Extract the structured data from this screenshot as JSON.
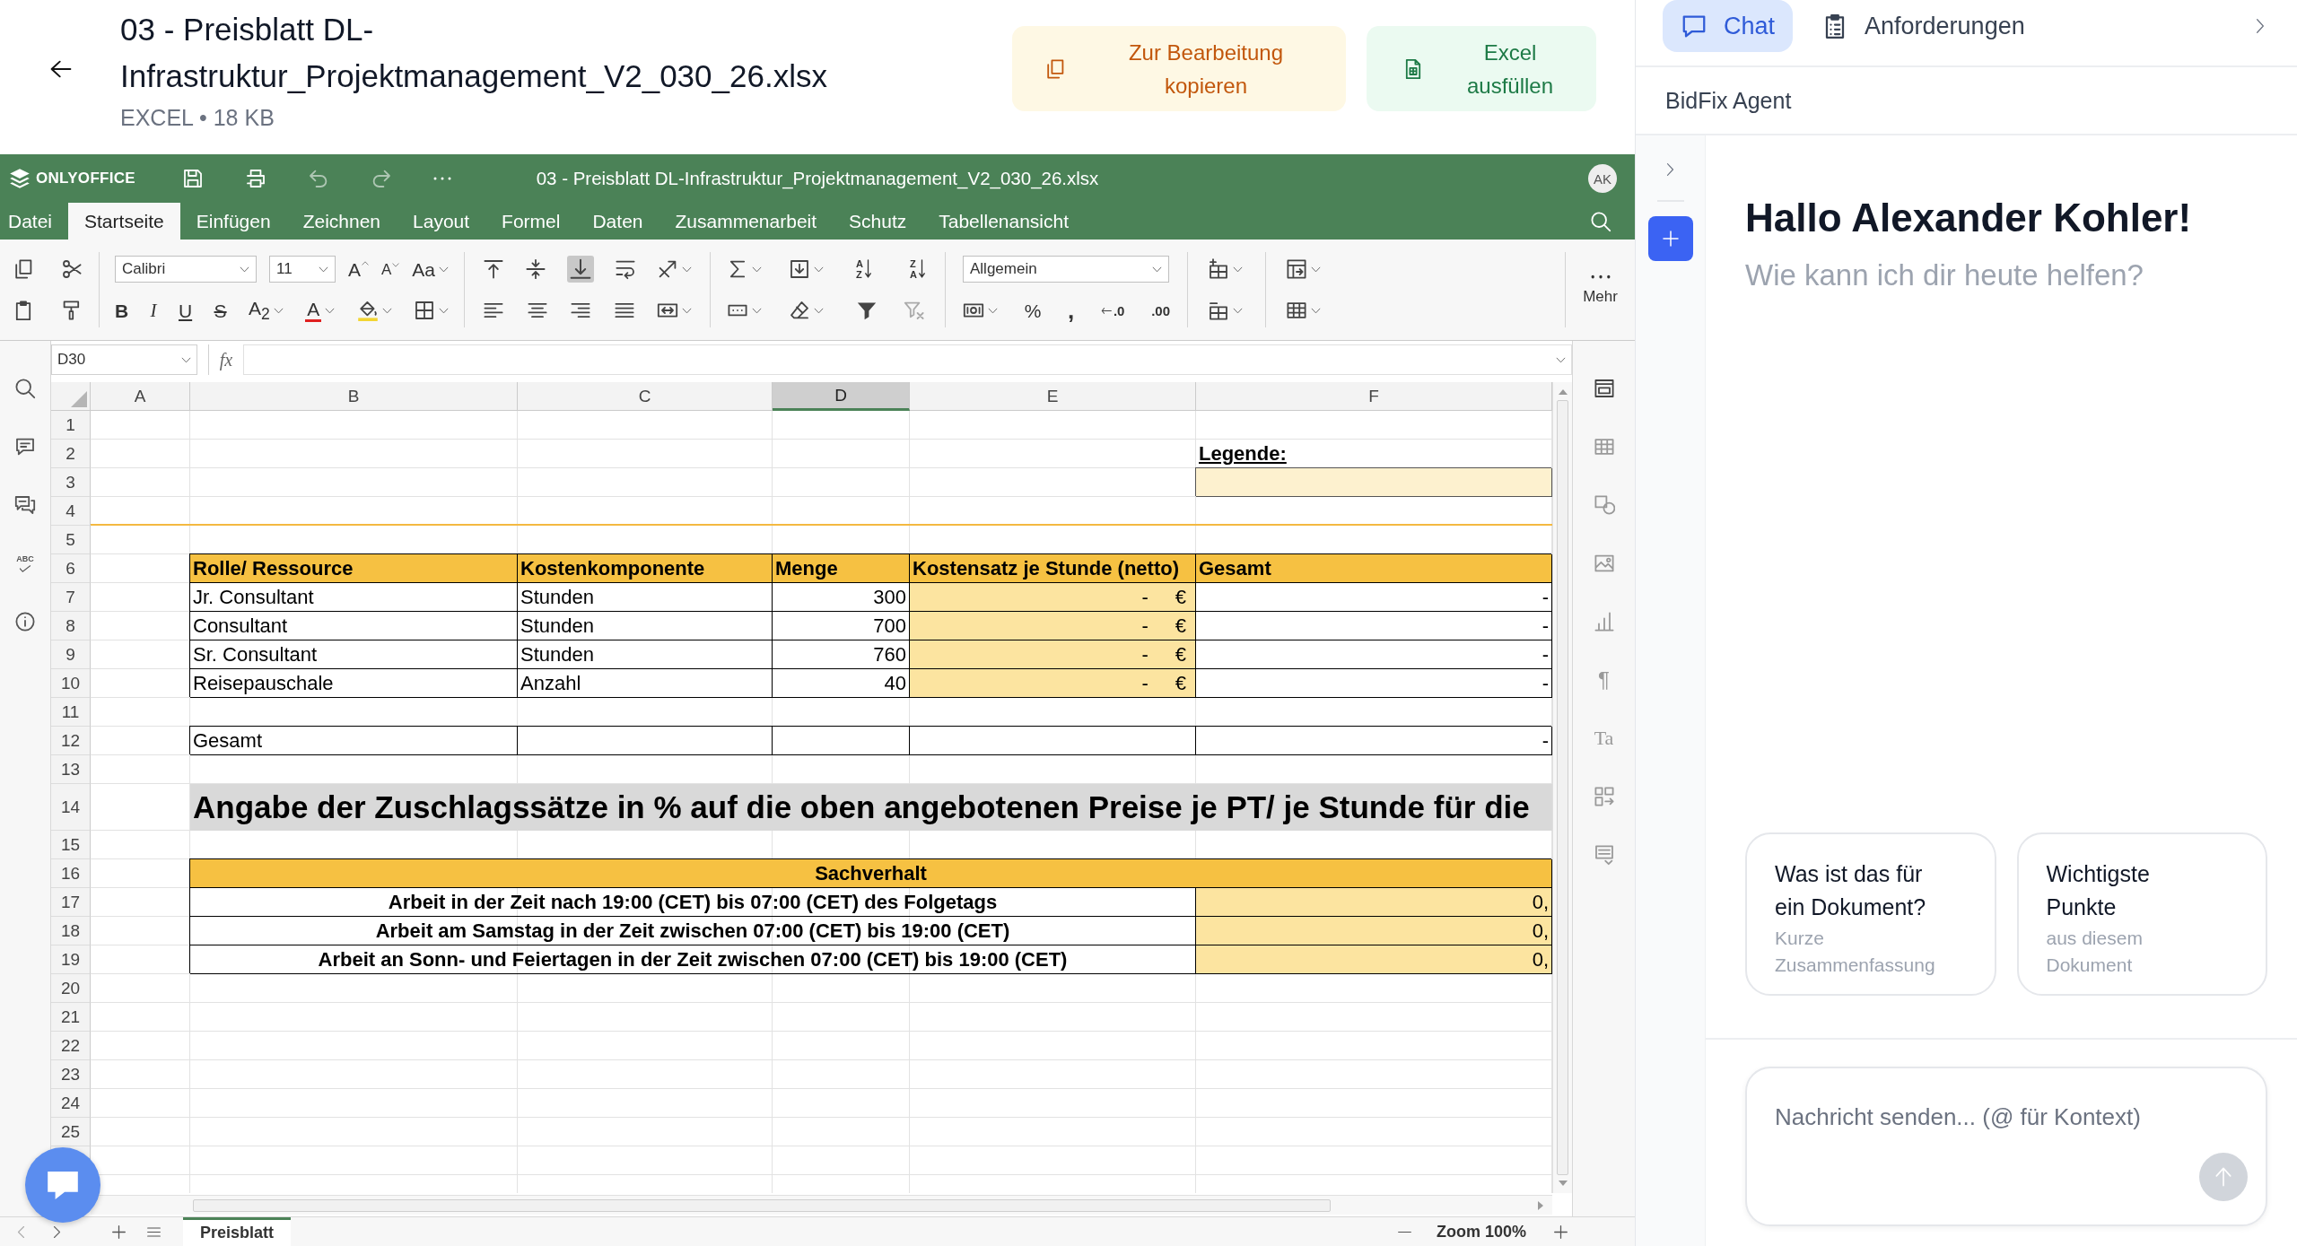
{
  "header": {
    "title": "03 - Preisblatt DL-Infrastruktur_Projektmanagement_V2_030_26.xlsx",
    "meta": "EXCEL • 18 KB",
    "actions": [
      {
        "kind": "copy",
        "label": "Zur Bearbeitung kopieren"
      },
      {
        "kind": "fill",
        "label": "Excel ausfüllen"
      }
    ]
  },
  "editor": {
    "brand": "ONLYOFFICE",
    "document_title": "03 - Preisblatt DL-Infrastruktur_Projektmanagement_V2_030_26.xlsx",
    "user_initials": "AK",
    "tabs": [
      {
        "label": "Datei",
        "selected": false
      },
      {
        "label": "Startseite",
        "selected": true
      },
      {
        "label": "Einfügen",
        "selected": false
      },
      {
        "label": "Zeichnen",
        "selected": false
      },
      {
        "label": "Layout",
        "selected": false
      },
      {
        "label": "Formel",
        "selected": false
      },
      {
        "label": "Daten",
        "selected": false
      },
      {
        "label": "Zusammenarbeit",
        "selected": false
      },
      {
        "label": "Schutz",
        "selected": false
      },
      {
        "label": "Tabellenansicht",
        "selected": false
      }
    ],
    "toolbar": {
      "font": "Calibri",
      "size": "11",
      "grow_font": "A",
      "shrink_font": "A",
      "change_case": "Aa",
      "bold": "B",
      "italic": "I",
      "underline": "U",
      "strikethrough": "S",
      "subscript": "A$_{2}$",
      "font_color": "A",
      "align_bottom_pressed": true,
      "sort_ascending": [
        "A",
        "Z"
      ],
      "sort_descending": [
        "Z",
        "A"
      ],
      "number_format": "Allgemein",
      "percent": "%",
      "thousands": ",",
      "decrease_decimals": ".0",
      "increase_decimals": ".00",
      "more": "Mehr"
    },
    "side_tools": {
      "spellcheck": "ABC",
      "paragraph": "¶",
      "text_art": "Ta"
    },
    "name_box": "D30",
    "formula_label": "fx",
    "columns": [
      {
        "label": "A",
        "selected": false
      },
      {
        "label": "B",
        "selected": false
      },
      {
        "label": "C",
        "selected": false
      },
      {
        "label": "D",
        "selected": true
      },
      {
        "label": "E",
        "selected": false
      },
      {
        "label": "F",
        "selected": false
      }
    ],
    "rows": [
      {
        "label": "1"
      },
      {
        "label": "2",
        "cells": [
          {
            "kind": "blank"
          },
          {
            "kind": "blank"
          },
          {
            "kind": "blank"
          },
          {
            "kind": "blank"
          },
          {
            "kind": "blank"
          },
          {
            "kind": "legend",
            "value": "Legende:"
          }
        ]
      },
      {
        "label": "3",
        "cells": [
          {
            "kind": "blank"
          },
          {
            "kind": "blank"
          },
          {
            "kind": "blank"
          },
          {
            "kind": "blank"
          },
          {
            "kind": "blank"
          },
          {
            "kind": "swatch"
          }
        ]
      },
      {
        "label": "4",
        "rule": true
      },
      {
        "label": "5"
      },
      {
        "label": "6",
        "cells": [
          {
            "kind": "blank"
          },
          {
            "kind": "head",
            "value": "Rolle/ Ressource"
          },
          {
            "kind": "head",
            "value": "Kostenkomponente"
          },
          {
            "kind": "head",
            "value": "Menge"
          },
          {
            "kind": "head",
            "value": "Kostensatz je Stunde (netto)"
          },
          {
            "kind": "head",
            "value": "Gesamt"
          }
        ]
      },
      {
        "label": "7",
        "cells": [
          {
            "kind": "blank"
          },
          {
            "kind": "text",
            "value": "Jr. Consultant"
          },
          {
            "kind": "text",
            "value": "Stunden"
          },
          {
            "kind": "number",
            "value": "300"
          },
          {
            "kind": "rate",
            "value": "-",
            "unit": "€"
          },
          {
            "kind": "number",
            "value": "-"
          }
        ]
      },
      {
        "label": "8",
        "cells": [
          {
            "kind": "blank"
          },
          {
            "kind": "text",
            "value": "Consultant"
          },
          {
            "kind": "text",
            "value": "Stunden"
          },
          {
            "kind": "number",
            "value": "700"
          },
          {
            "kind": "rate",
            "value": "-",
            "unit": "€"
          },
          {
            "kind": "number",
            "value": "-"
          }
        ]
      },
      {
        "label": "9",
        "cells": [
          {
            "kind": "blank"
          },
          {
            "kind": "text",
            "value": "Sr. Consultant"
          },
          {
            "kind": "text",
            "value": "Stunden"
          },
          {
            "kind": "number",
            "value": "760"
          },
          {
            "kind": "rate",
            "value": "-",
            "unit": "€"
          },
          {
            "kind": "number",
            "value": "-"
          }
        ]
      },
      {
        "label": "10",
        "cells": [
          {
            "kind": "blank"
          },
          {
            "kind": "text",
            "value": "Reisepauschale"
          },
          {
            "kind": "text",
            "value": "Anzahl"
          },
          {
            "kind": "number",
            "value": "40"
          },
          {
            "kind": "rate",
            "value": "-",
            "unit": "€"
          },
          {
            "kind": "number",
            "value": "-"
          }
        ]
      },
      {
        "label": "11"
      },
      {
        "label": "12",
        "cells": [
          {
            "kind": "blank"
          },
          {
            "kind": "text",
            "value": "Gesamt"
          },
          {
            "kind": "text"
          },
          {
            "kind": "text"
          },
          {
            "kind": "text"
          },
          {
            "kind": "number",
            "value": "-"
          }
        ]
      },
      {
        "label": "13"
      },
      {
        "label": "14",
        "cells": [
          {
            "kind": "blank"
          },
          {
            "kind": "banner",
            "value": "Angabe der Zuschlagssätze in % auf die oben angebotenen Preise je PT/ je Stunde für die"
          }
        ]
      },
      {
        "label": "15"
      },
      {
        "label": "16",
        "cells": [
          {
            "kind": "blank"
          },
          {
            "kind": "section",
            "value": "Sachverhalt"
          }
        ]
      },
      {
        "label": "17",
        "cells": [
          {
            "kind": "blank"
          },
          {
            "kind": "item",
            "value": "Arbeit in der Zeit nach 19:00 (CET) bis 07:00 (CET) des Folgetags"
          },
          {
            "kind": "percent",
            "value": "0,"
          }
        ]
      },
      {
        "label": "18",
        "cells": [
          {
            "kind": "blank"
          },
          {
            "kind": "item",
            "value": "Arbeit am Samstag in der Zeit zwischen 07:00 (CET) bis 19:00 (CET)"
          },
          {
            "kind": "percent",
            "value": "0,"
          }
        ]
      },
      {
        "label": "19",
        "cells": [
          {
            "kind": "blank"
          },
          {
            "kind": "item",
            "value": "Arbeit an Sonn- und Feiertagen in der Zeit zwischen 07:00 (CET) bis 19:00 (CET)"
          },
          {
            "kind": "percent",
            "value": "0,"
          }
        ]
      },
      {
        "label": "20"
      },
      {
        "label": "21"
      },
      {
        "label": "22"
      },
      {
        "label": "23"
      },
      {
        "label": "24"
      },
      {
        "label": "25"
      }
    ],
    "sheets": [
      {
        "label": "Preisblatt",
        "selected": true
      }
    ],
    "zoom": "Zoom 100%"
  },
  "assistant": {
    "tabs": [
      {
        "kind": "chat",
        "label": "Chat",
        "selected": true
      },
      {
        "kind": "requirements",
        "label": "Anforderungen",
        "selected": false
      }
    ],
    "agent": "BidFix Agent",
    "greeting": "Hallo Alexander Kohler!",
    "prompt": "Wie kann ich dir heute helfen?",
    "suggestions": [
      {
        "title": "Was ist das für ein Dokument?",
        "subtitle": "Kurze Zusammenfassung"
      },
      {
        "title": "Wichtigste Punkte",
        "subtitle": "aus diesem Dokument"
      }
    ],
    "composer": {
      "placeholder": "Nachricht senden... (@ für Kontext)"
    }
  }
}
